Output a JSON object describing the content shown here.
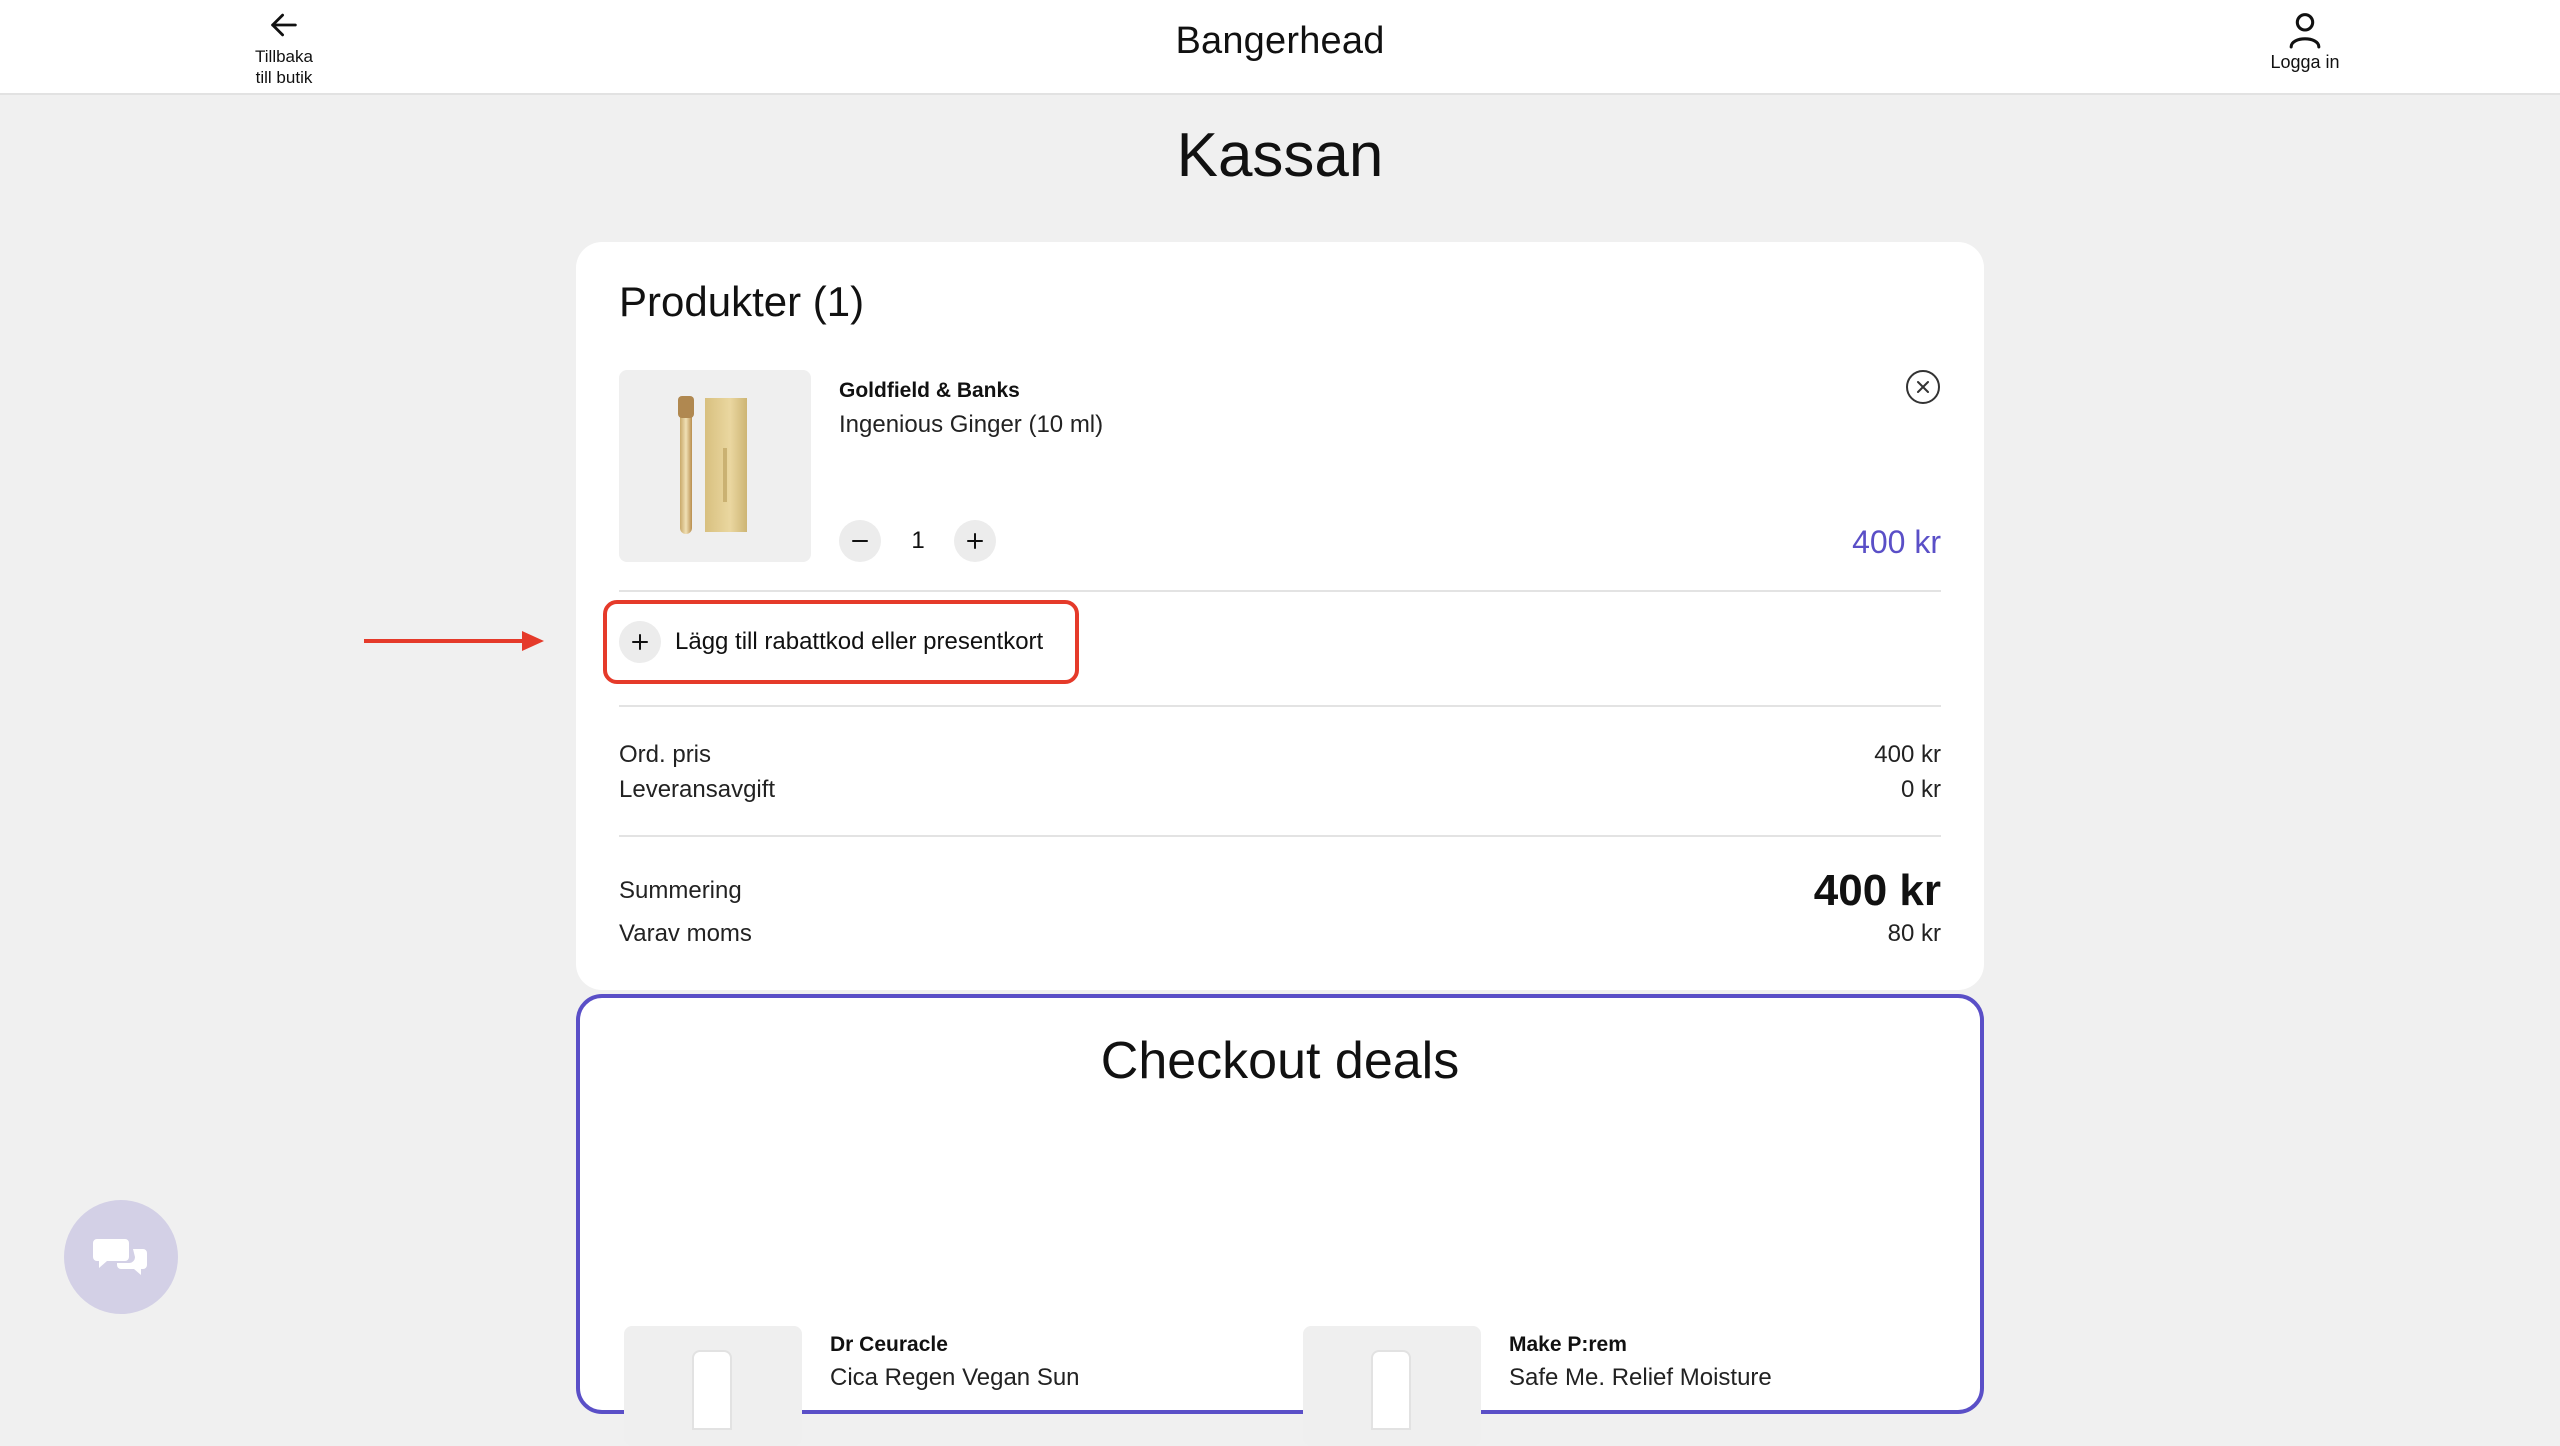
{
  "header": {
    "back_label_line1": "Tillbaka",
    "back_label_line2": "till butik",
    "brand": "Bangerhead",
    "login_label": "Logga in"
  },
  "page": {
    "title": "Kassan"
  },
  "cart": {
    "title": "Produkter (1)",
    "item": {
      "brand": "Goldfield & Banks",
      "name": "Ingenious Ginger (10 ml)",
      "quantity": "1",
      "price": "400 kr"
    },
    "discount_label": "Lägg till rabattkod eller presentkort",
    "summary": {
      "ord_pris_label": "Ord. pris",
      "ord_pris_value": "400 kr",
      "delivery_label": "Leveransavgift",
      "delivery_value": "0 kr",
      "total_label": "Summering",
      "total_value": "400 kr",
      "vat_label": "Varav moms",
      "vat_value": "80 kr"
    }
  },
  "deals": {
    "title": "Checkout deals",
    "items": [
      {
        "brand": "Dr Ceuracle",
        "name": "Cica Regen Vegan Sun"
      },
      {
        "brand": "Make P:rem",
        "name": "Safe Me. Relief Moisture"
      }
    ]
  },
  "colors": {
    "accent": "#5a4fc7",
    "annotation": "#e53a2a",
    "background": "#f0f0f0"
  },
  "icons": {
    "back": "arrow-left-icon",
    "login": "user-icon",
    "remove": "close-circle-icon",
    "minus": "minus-icon",
    "plus": "plus-icon",
    "chat": "chat-bubbles-icon"
  }
}
